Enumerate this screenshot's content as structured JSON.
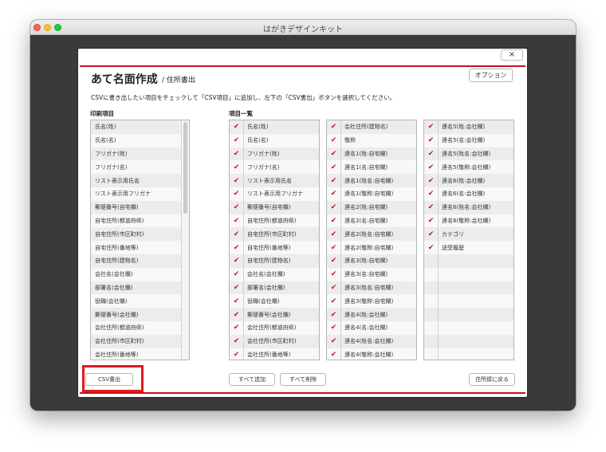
{
  "window": {
    "title": "はがきデザインキット"
  },
  "dialog": {
    "close_label": "×",
    "title": "あて名面作成",
    "subtitle": "/ 住所書出",
    "option_button": "オプション",
    "instructions": "CSVに書き出したい項目をチェックして「CSV項目」に追加し、左下の「CSV書出」ボタンを選択してください。",
    "print_items_label": "印刷項目",
    "item_list_label": "項目一覧",
    "print_items": [
      "氏名(姓)",
      "氏名(名)",
      "フリガナ(姓)",
      "フリガナ(名)",
      "リスト表示用氏名",
      "リスト表示用フリガナ",
      "郵便番号(自宅欄)",
      "自宅住所(都道府県)",
      "自宅住所(市区町村)",
      "自宅住所(番地等)",
      "自宅住所(建物名)",
      "会社名(会社欄)",
      "部署名(会社欄)",
      "役職(会社欄)",
      "郵便番号(会社欄)",
      "会社住所(都道府県)",
      "会社住所(市区町村)",
      "会社住所(番地等)"
    ],
    "items_col1": [
      "氏名(姓)",
      "氏名(名)",
      "フリガナ(姓)",
      "フリガナ(名)",
      "リスト表示用氏名",
      "リスト表示用フリガナ",
      "郵便番号(自宅欄)",
      "自宅住所(都道府県)",
      "自宅住所(市区町村)",
      "自宅住所(番地等)",
      "自宅住所(建物名)",
      "会社名(会社欄)",
      "部署名(会社欄)",
      "役職(会社欄)",
      "郵便番号(会社欄)",
      "会社住所(都道府県)",
      "会社住所(市区町村)",
      "会社住所(番地等)"
    ],
    "items_col2": [
      "会社住所(建物名)",
      "敬称",
      "連名1(姓:自宅欄)",
      "連名1(名:自宅欄)",
      "連名1(姓名:自宅欄)",
      "連名1(敬称:自宅欄)",
      "連名2(姓:自宅欄)",
      "連名2(名:自宅欄)",
      "連名2(姓名:自宅欄)",
      "連名2(敬称:自宅欄)",
      "連名3(姓:自宅欄)",
      "連名3(名:自宅欄)",
      "連名3(姓名:自宅欄)",
      "連名3(敬称:自宅欄)",
      "連名4(姓:会社欄)",
      "連名4(名:会社欄)",
      "連名4(姓名:会社欄)",
      "連名4(敬称:会社欄)"
    ],
    "items_col3": [
      "連名5(姓:会社欄)",
      "連名5(名:会社欄)",
      "連名5(姓名:会社欄)",
      "連名5(敬称:会社欄)",
      "連名6(姓:会社欄)",
      "連名6(名:会社欄)",
      "連名6(姓名:会社欄)",
      "連名6(敬称:会社欄)",
      "カテゴリ",
      "送受履歴",
      "",
      "",
      "",
      "",
      "",
      "",
      "",
      ""
    ],
    "check_mark": "✔",
    "csv_button": "CSV書出",
    "add_all_button": "すべて追加",
    "delete_all_button": "すべて削除",
    "back_button": "住所録に戻る"
  },
  "colors": {
    "accent": "#c4151c",
    "highlight": "#e0191f"
  }
}
